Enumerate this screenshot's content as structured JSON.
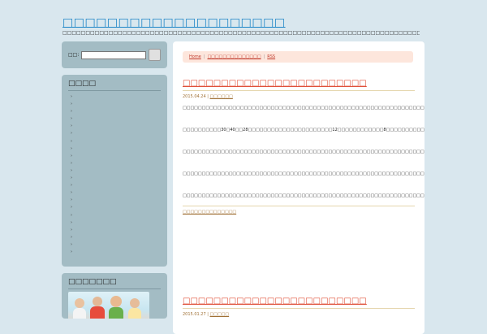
{
  "site": {
    "title": "□□□□□□□□□□□□□□□□□□□□",
    "description": "□□□□□□□□□□□□□□□□□□□□□□□□□□□□□□□□□□□□□□□□□□□□□□□□□□□□□□□□□□□□□□□□□□□□□□□□□□□□□□□□□□□□□□"
  },
  "sidebar": {
    "search_label": "□□:",
    "search_value": "",
    "menu_title": "□□□□",
    "menu_items": [
      "›",
      "›",
      "›",
      "›",
      "›",
      "›",
      "›",
      "›",
      "›",
      "›",
      "›",
      "›",
      "›",
      "›",
      "›",
      "›",
      "›",
      "›",
      "›",
      "›",
      "›",
      "›"
    ],
    "photo_title": "□□□□□□□"
  },
  "breadcrumb": {
    "home": "Home",
    "middle": "□□□□□□□□□□□□□□",
    "rss": "RSS",
    "sep": "|"
  },
  "posts": [
    {
      "title": "□□□□□□□□□□□□□□□□□□□□□□□□",
      "date": "2015.04.24",
      "sep": "|",
      "category": "□□□□□□",
      "paragraphs": [
        "□□□□□□□□□□□□□□□□□□□□□□□□□□□□□□□□□□□□□□□□□□□□□□□□□□□□□□□□□□□□□□□□□□□□□□□□□□□□□□□□□□□□□□□□□□□□□□□□□□□□□□□□□□□□□□□□□□□□□□□□□",
        "□□□□□□□□□□30□40□□28□□□□□□□□□□□□□□□□□□□□□□12□□□□□□□□□□□□8□□□□□□□□□□□□□□□8□□□□□□□□□□□□□□□□□□□□□□□□□□□□□□□□□□□□3□1□1□□□8□□□□□□□□□□□□□□",
        "□□□□□□□□□□□□□□□□□□□□□□□□□□□□□□□□□□□□□□□□□□□□□□□□□□□□□□□□□□□□□□□□□□Th/Ts□□□□□□□□□□□□□□□□□□□□□□□□□□□□□□□□□□□□□□□□□□□□□□□□□□□□□□□□□□□□□□□□□□□",
        "□□□□□□□□□□□□□□□□□□□□□□□□□□□□□□□□□□□□□□□□□□□□□□□□□□□□□□□□□□□□□□□",
        "□□□□□□□□□□□□□□□□□□□□□□□□□□□□□□□□□□□□□□□□□□□□□□□□□□□□□□□□□□□□□□□□□□□□□□□□□□□□□□□□□□□□□□□□□□□□□□□□□□□"
      ],
      "more": "□□□□□□□□□□□□□□"
    },
    {
      "title": "□□□□□□□□□□□□□□□□□□□□□□□□",
      "date": "2015.01.27",
      "sep": "|",
      "category": "□□□□□"
    }
  ],
  "colors": {
    "page_bg": "#d9e7ee",
    "sidebar_box": "#a3bcc4",
    "title_link": "#1f86c7",
    "post_title": "#e0513a",
    "meta": "#a07035",
    "breadcrumb_bg": "#fde6dc"
  }
}
